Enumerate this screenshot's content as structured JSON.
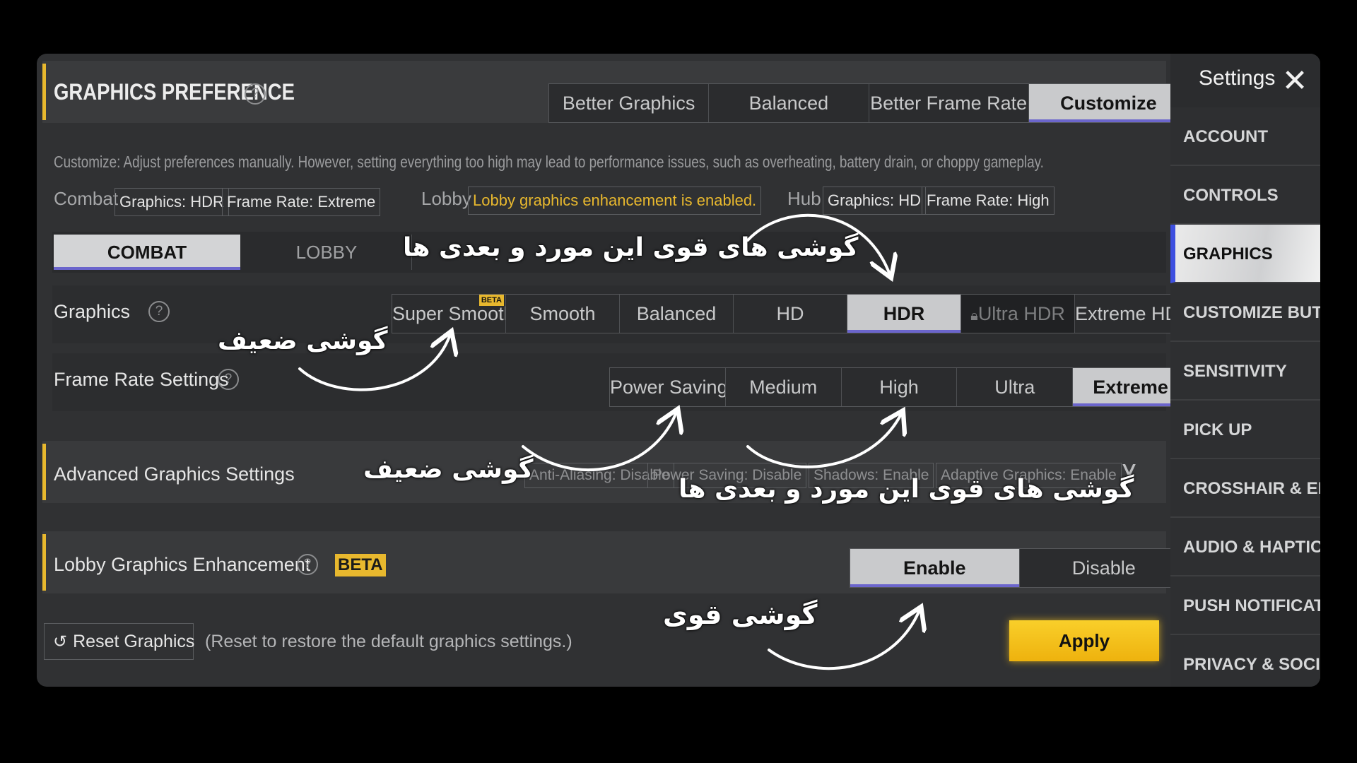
{
  "header": {
    "title": "GRAPHICS PREFERENCE",
    "help_icon": "question-circle-icon",
    "presets": [
      "Better Graphics",
      "Balanced",
      "Better Frame Rate",
      "Customize"
    ],
    "selected_preset": "Customize"
  },
  "description": "Customize: Adjust preferences manually. However, setting everything too high may lead to performance issues, such as overheating, battery drain, or choppy gameplay.",
  "summary": {
    "combat_label": "Combat",
    "combat_graphics": "Graphics: HDR",
    "combat_frame_rate": "Frame Rate: Extreme",
    "lobby_label": "Lobby",
    "lobby_status": "Lobby graphics enhancement is enabled.",
    "hub_label": "Hub",
    "hub_graphics": "Graphics: HD",
    "hub_frame_rate": "Frame Rate: High"
  },
  "mode_tabs": [
    "COMBAT",
    "LOBBY"
  ],
  "graphics": {
    "label": "Graphics",
    "options": [
      "Super Smooth",
      "Smooth",
      "Balanced",
      "HD",
      "HDR",
      "Ultra HDR",
      "Extreme HDR"
    ],
    "selected": "HDR",
    "beta_badge": "BETA",
    "locked_icon": "lock-icon"
  },
  "frame_rate": {
    "label": "Frame Rate Settings",
    "options": [
      "Power Saving",
      "Medium",
      "High",
      "Ultra",
      "Extreme"
    ],
    "selected": "Extreme"
  },
  "advanced": {
    "label": "Advanced Graphics Settings",
    "chips": [
      "Anti-Aliasing: Disable",
      "Power Saving: Disable",
      "Shadows: Enable",
      "Adaptive Graphics: Enable"
    ],
    "expand_icon": "chevron-down-icon"
  },
  "lobby_enhancement": {
    "label": "Lobby Graphics Enhancement",
    "beta_badge": "BETA",
    "options": [
      "Enable",
      "Disable"
    ],
    "selected": "Enable"
  },
  "footer": {
    "reset_label": "Reset Graphics",
    "reset_hint": "(Reset to restore the default graphics settings.)",
    "apply_label": "Apply",
    "reset_icon": "undo-icon"
  },
  "sidebar": {
    "title": "Settings",
    "close_icon": "close-icon",
    "items": [
      "ACCOUNT",
      "CONTROLS",
      "GRAPHICS",
      "CUSTOMIZE BUTTONS",
      "SENSITIVITY",
      "PICK UP",
      "CROSSHAIR & EFFECTS",
      "AUDIO & HAPTICS",
      "PUSH NOTIFICATIONS",
      "PRIVACY & SOCIAL"
    ],
    "selected": "GRAPHICS"
  },
  "annotations": {
    "strong_phones_1": "گوشی های قوی این مورد و بعدی ها",
    "weak_phone_1": "گوشی ضعیف",
    "weak_phone_2": "گوشی ضعیف",
    "strong_phones_2": "گوشی های قوی این مورد و بعدی ها",
    "strong_phone": "گوشی قوی"
  },
  "colors": {
    "accent_gold": "#e8b82e",
    "selection_underline": "#6b65cc",
    "sidebar_selected_stripe": "#3d4fe0",
    "apply_button": "#f4c21c"
  }
}
